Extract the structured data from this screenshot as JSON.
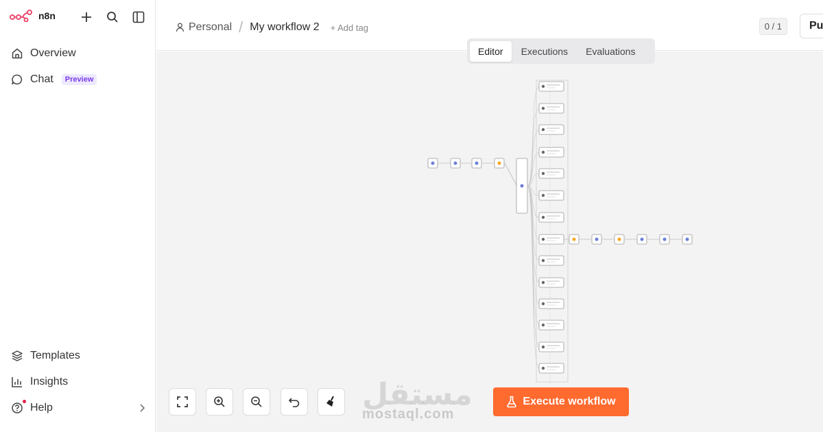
{
  "app": {
    "name": "n8n",
    "brand_color": "#ea4b71"
  },
  "sidebar": {
    "top_actions": [
      {
        "icon": "plus-icon"
      },
      {
        "icon": "search-icon"
      },
      {
        "icon": "sidebar-toggle-icon"
      }
    ],
    "items": [
      {
        "label": "Overview",
        "icon": "home-icon"
      },
      {
        "label": "Chat",
        "icon": "chat-icon",
        "badge": "Preview"
      }
    ],
    "bottom_items": [
      {
        "label": "Templates",
        "icon": "templates-icon"
      },
      {
        "label": "Insights",
        "icon": "insights-icon"
      },
      {
        "label": "Help",
        "icon": "help-icon",
        "has_notification": true
      }
    ]
  },
  "header": {
    "breadcrumb": {
      "project": "Personal",
      "workflow": "My workflow 2"
    },
    "add_tag": "+ Add tag",
    "counter": "0 / 1",
    "publish_label": "Pu"
  },
  "tabs": [
    {
      "label": "Editor",
      "active": true
    },
    {
      "label": "Executions",
      "active": false
    },
    {
      "label": "Evaluations",
      "active": false
    }
  ],
  "canvas": {
    "background": "#f3f3f3",
    "controls": [
      {
        "name": "fit-view-button",
        "icon": "fit-view-icon"
      },
      {
        "name": "zoom-in-button",
        "icon": "zoom-in-icon"
      },
      {
        "name": "zoom-out-button",
        "icon": "zoom-out-icon"
      },
      {
        "name": "undo-button",
        "icon": "undo-icon"
      },
      {
        "name": "clear-button",
        "icon": "broom-icon"
      }
    ],
    "execute_label": "Execute workflow",
    "execute_color": "#ff6a2f"
  },
  "watermark": {
    "arabic": "مستقل",
    "latin": "mostaql.com"
  }
}
